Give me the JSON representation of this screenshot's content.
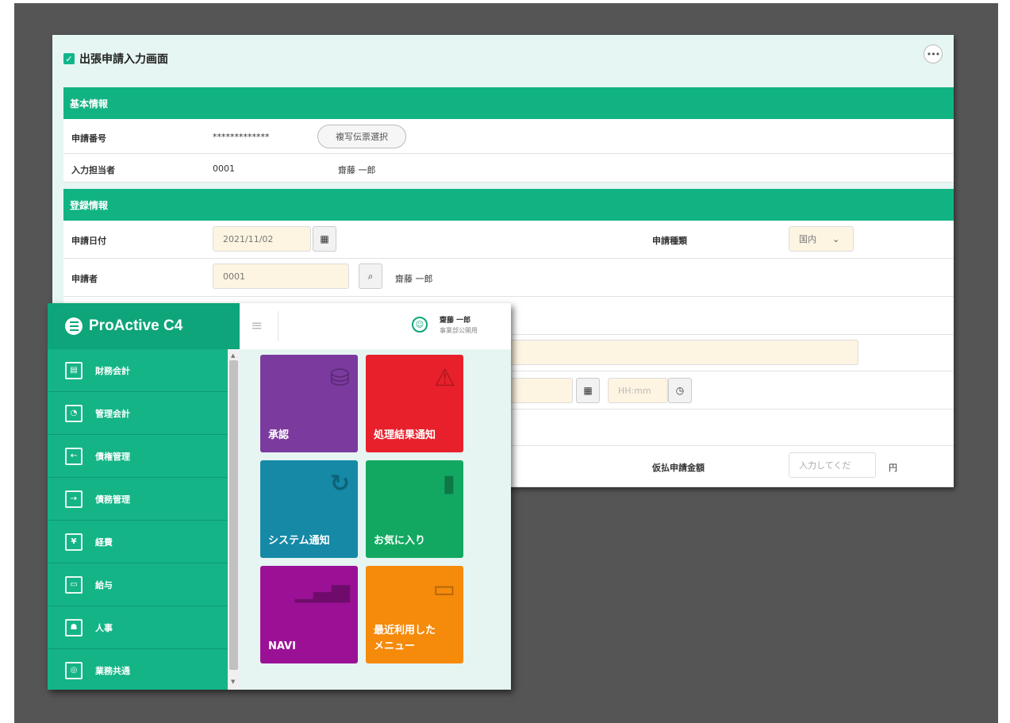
{
  "form": {
    "title": "出張申請入力画面",
    "more_label": "•••",
    "section_basic": "基本情報",
    "section_register": "登録情報",
    "app_no_label": "申請番号",
    "app_no_value": "*************",
    "copy_button": "複写伝票選択",
    "entry_person_label": "入力担当者",
    "entry_person_code": "0001",
    "entry_person_name": "齋藤 一郎",
    "app_date_label": "申請日付",
    "app_date_value": "2021/11/02",
    "app_type_label": "申請種類",
    "app_type_value": "国内",
    "applicant_label": "申請者",
    "applicant_code": "0001",
    "applicant_name": "齋藤 一郎",
    "time_placeholder": "HH:mm",
    "advance_label": "仮払申請金額",
    "advance_placeholder": "入力してくだ",
    "advance_unit": "円"
  },
  "menu": {
    "logo_text": "ProActive C4",
    "user_name": "齋藤 一郎",
    "user_dept": "事業部公開用",
    "sidebar": [
      {
        "label": "財務会計",
        "icon": "finance-icon"
      },
      {
        "label": "管理会計",
        "icon": "management-accounting-icon"
      },
      {
        "label": "債権管理",
        "icon": "receivables-icon"
      },
      {
        "label": "債務管理",
        "icon": "payables-icon"
      },
      {
        "label": "経費",
        "icon": "expense-icon"
      },
      {
        "label": "給与",
        "icon": "payroll-icon"
      },
      {
        "label": "人事",
        "icon": "hr-icon"
      },
      {
        "label": "業務共通",
        "icon": "common-icon"
      }
    ],
    "tiles": [
      {
        "label": "承認",
        "color": "#7b3a9e",
        "icon": "stamp-icon"
      },
      {
        "label": "処理結果通知",
        "color": "#e8202b",
        "icon": "warning-icon"
      },
      {
        "label": "システム通知",
        "color": "#1589a6",
        "icon": "refresh-icon"
      },
      {
        "label": "お気に入り",
        "color": "#13a862",
        "icon": "clipboard-icon"
      },
      {
        "label": "NAVI",
        "color": "#9b1196",
        "icon": "signal-icon"
      },
      {
        "label": "最近利用した\nメニュー",
        "color": "#f58a0b",
        "icon": "monitor-icon"
      }
    ]
  }
}
